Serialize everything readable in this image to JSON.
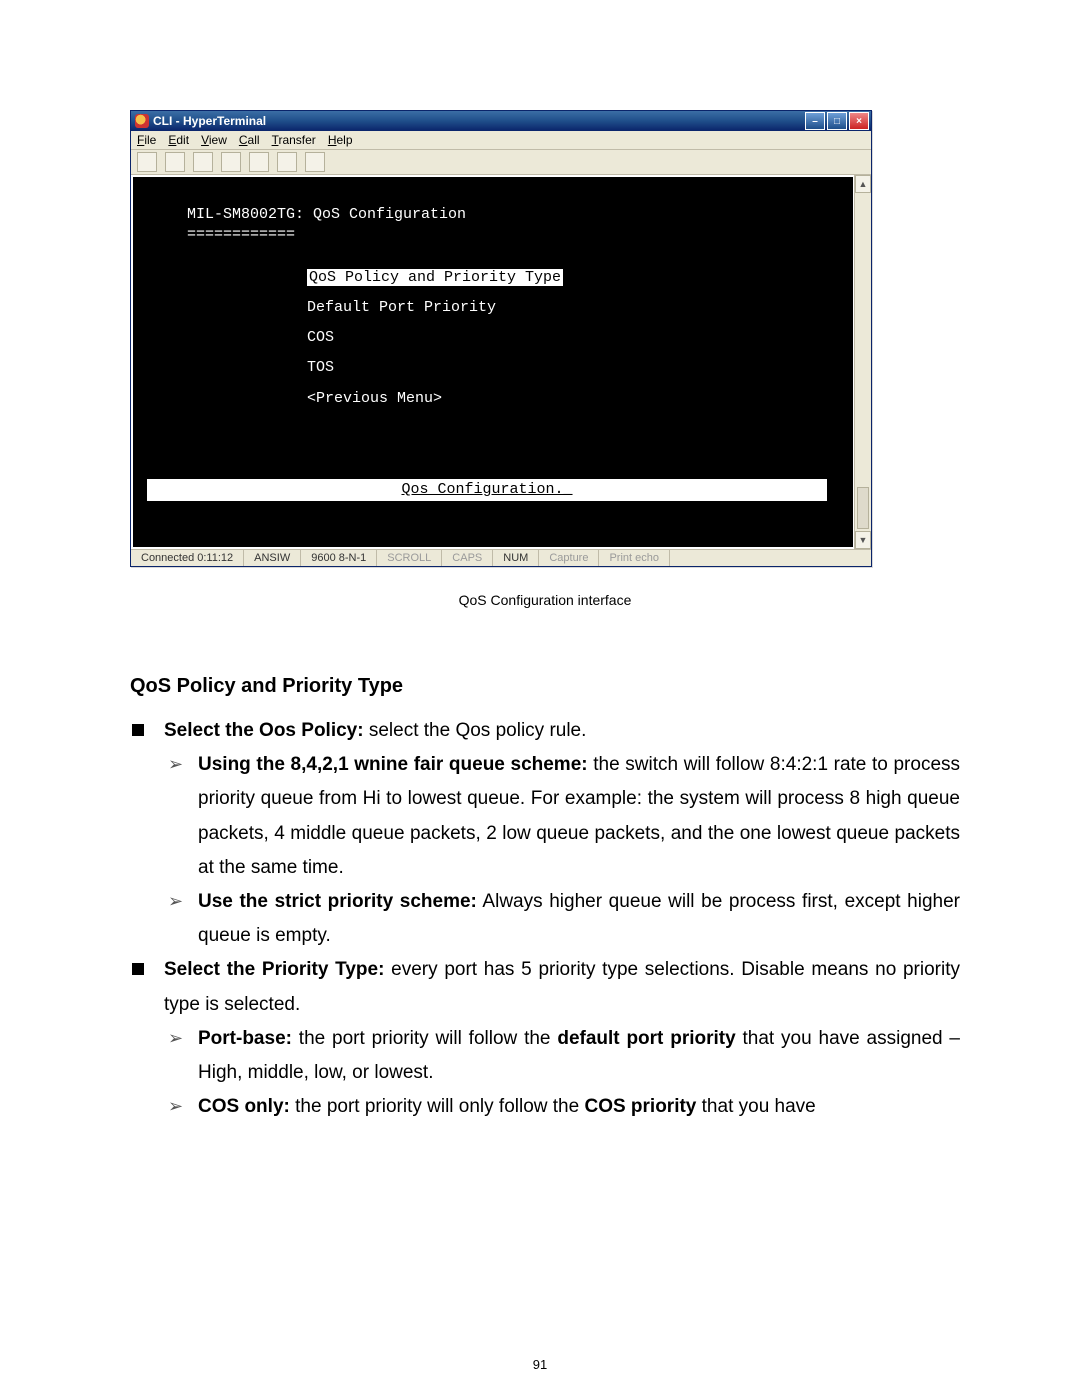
{
  "window": {
    "title": "CLI - HyperTerminal",
    "menus": [
      "File",
      "Edit",
      "View",
      "Call",
      "Transfer",
      "Help"
    ]
  },
  "terminal": {
    "header": "MIL-SM8002TG: QoS Configuration",
    "underline": "============",
    "menu_items": {
      "selected": "QoS Policy and Priority Type",
      "i1": "Default Port Priority",
      "i2": "COS",
      "i3": "TOS",
      "i4": "<Previous Menu>"
    },
    "footer": "Qos Configuration._"
  },
  "status": {
    "connected": "Connected 0:11:12",
    "emu": "ANSIW",
    "line": "9600 8-N-1",
    "scroll": "SCROLL",
    "caps": "CAPS",
    "num": "NUM",
    "capture": "Capture",
    "echo": "Print echo"
  },
  "caption": "QoS Configuration interface",
  "doc": {
    "h3": "QoS Policy and Priority Type",
    "b1a_strong": "Select the Oos Policy:",
    "b1a_rest": " select the Qos policy rule.",
    "b2a_strong": "Using the 8,4,2,1 wnine fair queue scheme:",
    "b2a_rest": " the switch will follow 8:4:2:1 rate to process priority queue from Hi to lowest queue. For example: the system will process 8 high queue packets, 4 middle queue packets, 2 low queue packets, and the one lowest queue packets at the same time.",
    "b2b_strong": "Use the strict priority scheme:",
    "b2b_rest": " Always higher queue will be process first, except higher queue is empty.",
    "b1b_strong": "Select the Priority Type:",
    "b1b_rest": " every port has 5 priority type selections. Disable means no priority type is selected.",
    "b2c_strong": "Port-base:",
    "b2c_rest_a": " the port priority will follow the ",
    "b2c_rest_bold": "default port priority",
    "b2c_rest_b": " that you have assigned – High, middle, low, or lowest.",
    "b2d_strong": "COS only:",
    "b2d_rest_a": " the port priority will only follow the ",
    "b2d_rest_bold": "COS priority",
    "b2d_rest_b": " that you have"
  },
  "page_number": "91"
}
